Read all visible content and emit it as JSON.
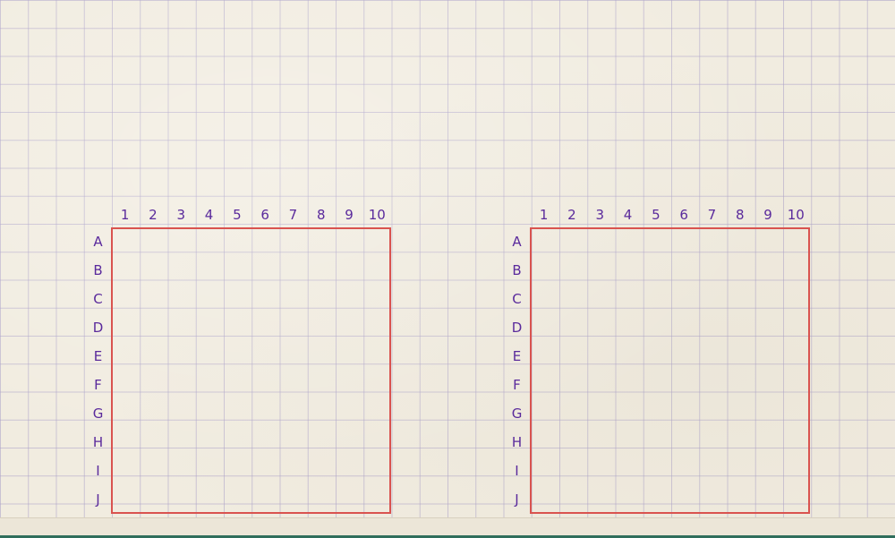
{
  "boards": [
    {
      "id": "player",
      "columns": [
        "1",
        "2",
        "3",
        "4",
        "5",
        "6",
        "7",
        "8",
        "9",
        "10"
      ],
      "rows": [
        "A",
        "B",
        "C",
        "D",
        "E",
        "F",
        "G",
        "H",
        "I",
        "J"
      ]
    },
    {
      "id": "enemy",
      "columns": [
        "1",
        "2",
        "3",
        "4",
        "5",
        "6",
        "7",
        "8",
        "9",
        "10"
      ],
      "rows": [
        "A",
        "B",
        "C",
        "D",
        "E",
        "F",
        "G",
        "H",
        "I",
        "J"
      ]
    }
  ],
  "colors": {
    "paper": "#f1ece0",
    "grid_line": "#aaa0c8",
    "label": "#5a2a9c",
    "board_border": "#d9534f",
    "footer_accent": "#2f6e5c"
  }
}
